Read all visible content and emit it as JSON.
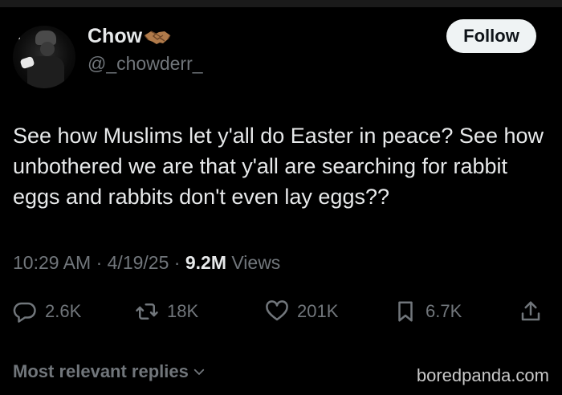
{
  "author": {
    "display_name": "Chow",
    "name_emoji_icon": "handshake-icon",
    "handle": "@_chowderr_",
    "avatar_icon": "avatar"
  },
  "follow_button": {
    "label": "Follow"
  },
  "tweet": {
    "text": "See how Muslims let y'all do Easter in peace? See how unbothered we are that y'all are searching for rabbit eggs and rabbits don't even lay eggs??"
  },
  "meta": {
    "time": "10:29 AM",
    "separator": "·",
    "date": "4/19/25",
    "views_count": "9.2M",
    "views_label": "Views"
  },
  "actions": {
    "replies": "2.6K",
    "reposts": "18K",
    "likes": "201K",
    "bookmarks": "6.7K"
  },
  "replies_sort": {
    "label": "Most relevant replies"
  },
  "watermark": {
    "text": "boredpanda.com"
  },
  "colors": {
    "background": "#000000",
    "text_primary": "#e7e9ea",
    "text_secondary": "#71767b",
    "follow_bg": "#eff3f4"
  }
}
